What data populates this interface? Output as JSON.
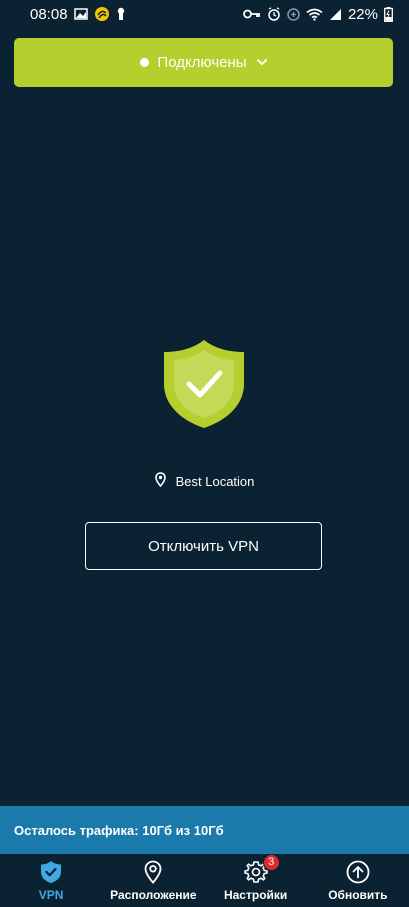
{
  "status_bar": {
    "time": "08:08",
    "battery": "22%"
  },
  "connection": {
    "status_label": "Подключены"
  },
  "location": {
    "label": "Best Location"
  },
  "disconnect_button": {
    "label": "Отключить VPN"
  },
  "traffic": {
    "label": "Осталось трафика: 10Гб из 10Гб"
  },
  "nav": {
    "items": [
      {
        "label": "VPN",
        "icon": "shield-check-icon",
        "active": true
      },
      {
        "label": "Расположение",
        "icon": "location-pin-icon",
        "active": false
      },
      {
        "label": "Настройки",
        "icon": "gear-icon",
        "active": false,
        "badge": "3"
      },
      {
        "label": "Обновить",
        "icon": "upgrade-arrow-icon",
        "active": false
      }
    ]
  },
  "colors": {
    "background": "#0b2233",
    "accent_green": "#b5cf2f",
    "traffic_bar": "#1a7aab",
    "nav_active": "#3fa9e0",
    "badge": "#e0282f"
  }
}
